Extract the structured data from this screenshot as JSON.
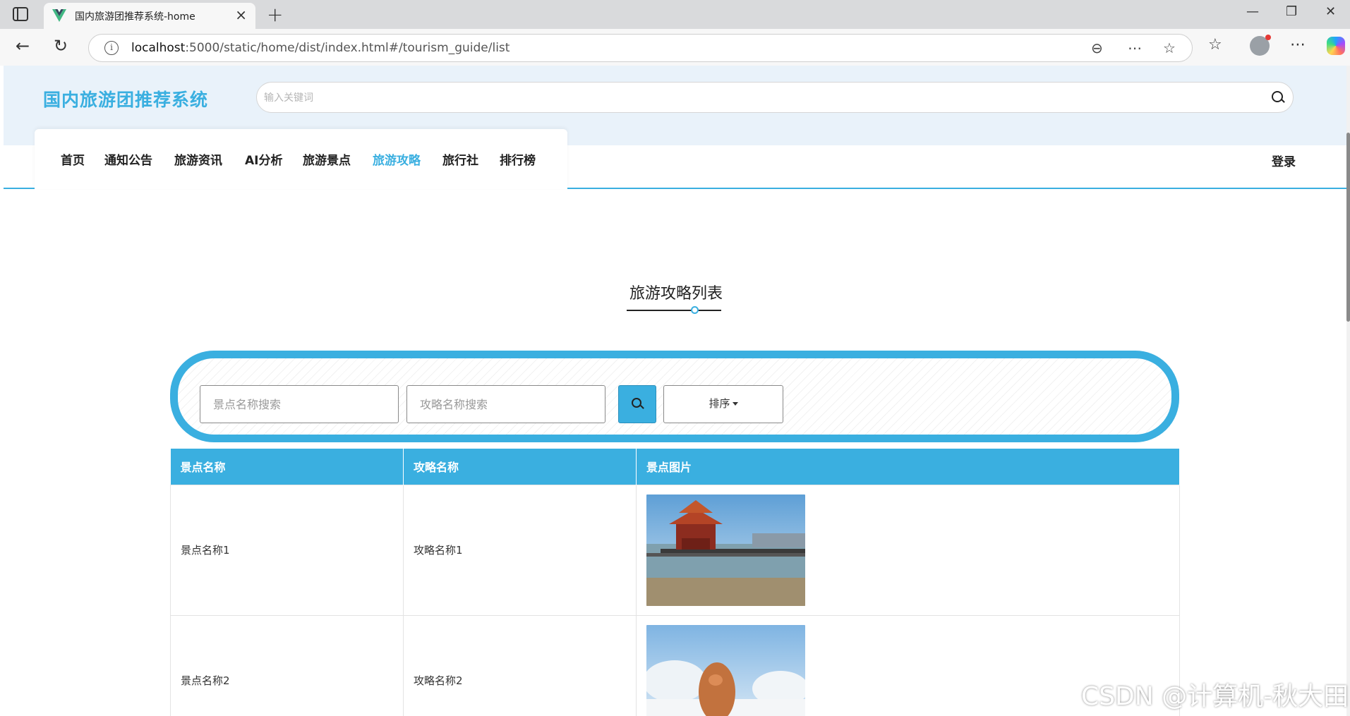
{
  "browser": {
    "tab_title": "国内旅游团推荐系统-home",
    "url_host": "localhost",
    "url_path": ":5000/static/home/dist/index.html#/tourism_guide/list"
  },
  "header": {
    "site_title": "国内旅游团推荐系统",
    "search_placeholder": "输入关键词"
  },
  "nav": {
    "items": [
      {
        "label": "首页",
        "active": false
      },
      {
        "label": "通知公告",
        "active": false
      },
      {
        "label": "旅游资讯",
        "active": false
      },
      {
        "label": "AI分析",
        "active": false
      },
      {
        "label": "旅游景点",
        "active": false
      },
      {
        "label": "旅游攻略",
        "active": true
      },
      {
        "label": "旅行社",
        "active": false
      },
      {
        "label": "排行榜",
        "active": false
      }
    ],
    "login_label": "登录"
  },
  "main": {
    "title": "旅游攻略列表",
    "filters": {
      "spot_placeholder": "景点名称搜索",
      "guide_placeholder": "攻略名称搜索",
      "sort_label": "排序"
    },
    "table": {
      "columns": [
        "景点名称",
        "攻略名称",
        "景点图片"
      ],
      "rows": [
        {
          "spot": "景点名称1",
          "guide": "攻略名称1",
          "image": "pier-pavilion-photo"
        },
        {
          "spot": "景点名称2",
          "guide": "攻略名称2",
          "image": "snowy-rock-photo"
        }
      ]
    }
  },
  "watermark": "CSDN @计算机-秋大田",
  "colors": {
    "accent": "#3aafe0",
    "header_band": "#e9f2fa",
    "text": "#222222"
  }
}
